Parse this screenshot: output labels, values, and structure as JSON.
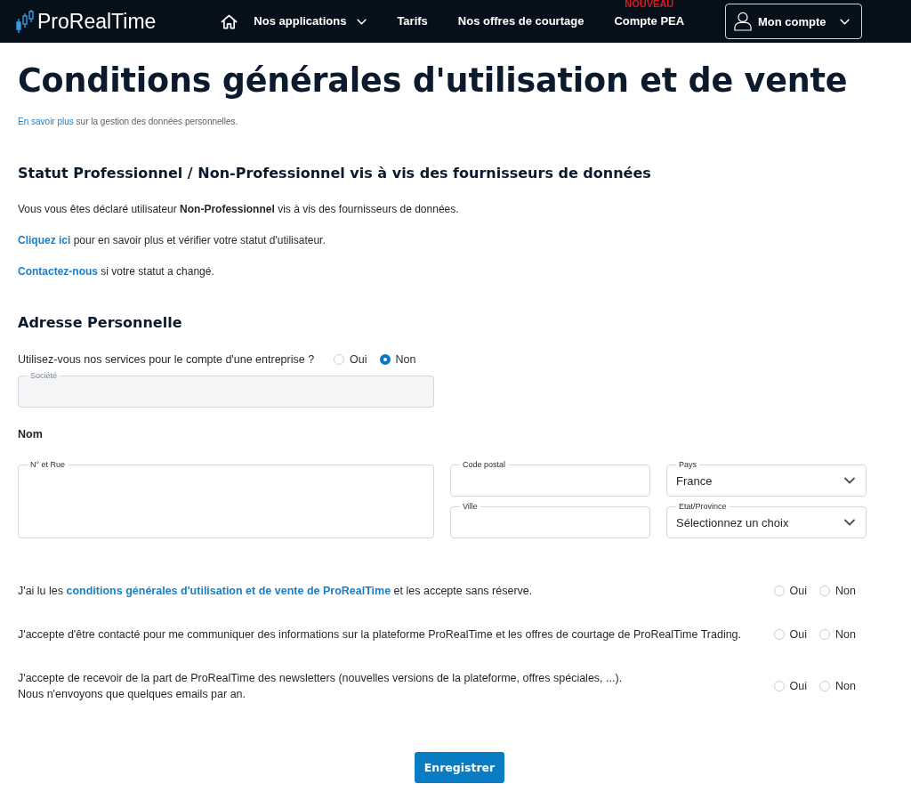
{
  "header": {
    "logo": "ProRealTime",
    "nav": [
      {
        "label": "Nos applications",
        "kind": "dropdown"
      },
      {
        "label": "Tarifs",
        "kind": "link"
      },
      {
        "label": "Nos offres de courtage",
        "kind": "link"
      },
      {
        "label": "Compte PEA",
        "kind": "link",
        "badge": "NOUVEAU"
      }
    ],
    "account": {
      "label": "Mon compte"
    }
  },
  "title": "Conditions générales d'utilisation et de vente",
  "privacy_note": [
    {
      "kind": "link",
      "text": "En savoir plus"
    },
    {
      "kind": "text",
      "text": " sur la gestion des données personnelles."
    }
  ],
  "status_section": {
    "title": "Statut Professionnel / Non-Professionnel vis à vis des fournisseurs de données",
    "paragraphs": [
      [
        {
          "kind": "text",
          "text": "Vous vous êtes déclaré utilisateur **Non-Professionnel** vis à vis des fournisseurs de données."
        }
      ],
      [
        {
          "kind": "link",
          "text": "Cliquez ici"
        },
        {
          "kind": "text",
          "text": " pour en savoir plus et vérifier votre statut d'utilisateur."
        }
      ],
      [
        {
          "kind": "link",
          "text": "Contactez-nous"
        },
        {
          "kind": "text",
          "text": " si votre statut a changé."
        }
      ]
    ]
  },
  "address": {
    "title": "Adresse Personnelle",
    "company_question": {
      "label": "Utilisez-vous nos services pour le compte d'une entreprise ?",
      "options": [
        {
          "label": "Oui",
          "selected": false
        },
        {
          "label": "Non",
          "selected": true
        }
      ]
    },
    "company_field": {
      "label": "Société",
      "disabled": true
    },
    "name_label": "Nom",
    "fields": [
      {
        "kind": "textarea",
        "label": "N° et Rue"
      },
      {
        "kind": "input",
        "label": "Code postal"
      },
      {
        "kind": "select",
        "label": "Pays",
        "value": "France"
      },
      {
        "kind": "input",
        "label": "Ville"
      },
      {
        "kind": "select",
        "label": "Etat/Province",
        "value": "Sélectionnez un choix"
      }
    ]
  },
  "consents": [
    {
      "parts": [
        {
          "kind": "text",
          "text": "J'ai lu les "
        },
        {
          "kind": "link",
          "text": "conditions générales d'utilisation et de vente de ProRealTime"
        },
        {
          "kind": "text",
          "text": " et les accepte sans réserve."
        }
      ],
      "options": [
        {
          "label": "Oui",
          "selected": false
        },
        {
          "label": "Non",
          "selected": false
        }
      ]
    },
    {
      "parts": [
        {
          "kind": "text",
          "text": "J'accepte d'être contacté pour me communiquer des informations sur la plateforme ProRealTime et les offres de courtage de ProRealTime Trading."
        }
      ],
      "options": [
        {
          "label": "Oui",
          "selected": false
        },
        {
          "label": "Non",
          "selected": false
        }
      ]
    },
    {
      "parts": [
        {
          "kind": "text",
          "text": "J'accepte de recevoir de la part de ProRealTime des newsletters (nouvelles versions de la plateforme, offres spéciales, ...).\nNous n'envoyons que quelques emails par an."
        }
      ],
      "options": [
        {
          "label": "Oui",
          "selected": false
        },
        {
          "label": "Non",
          "selected": false
        }
      ]
    }
  ],
  "submit": {
    "label": "Enregistrer"
  }
}
